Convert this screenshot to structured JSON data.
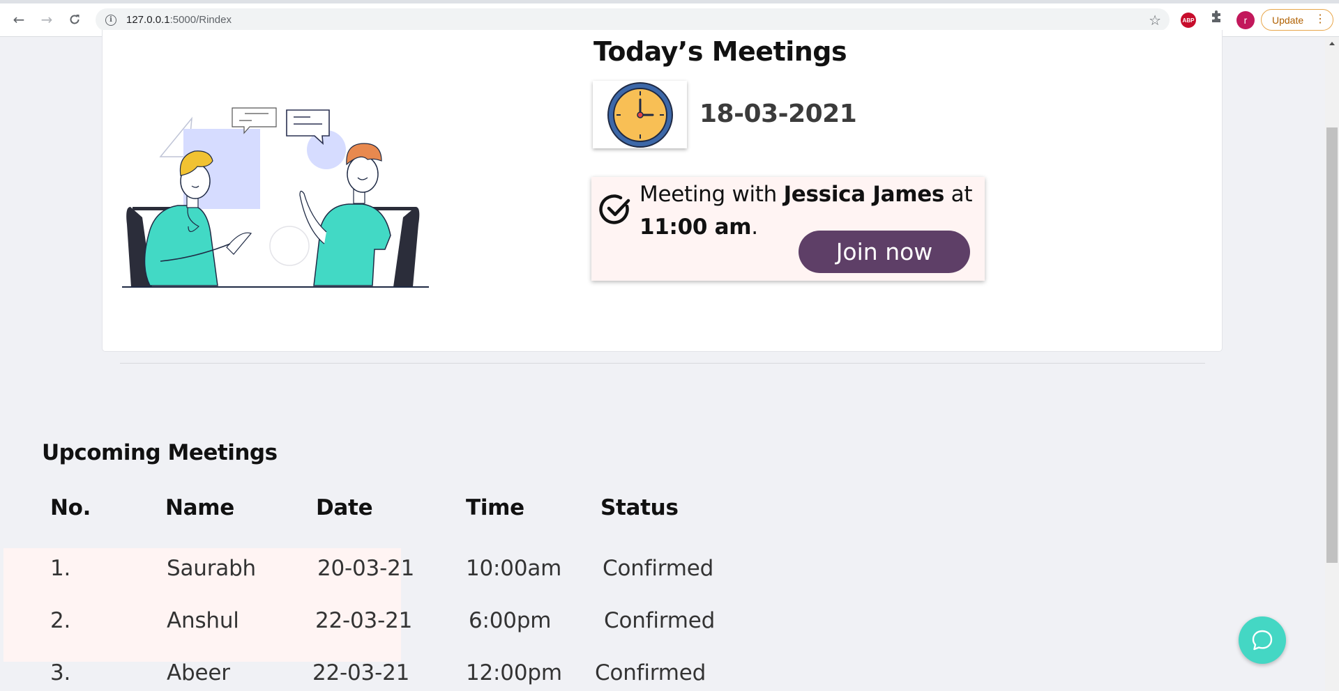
{
  "browser": {
    "url_host": "127.0.0.1",
    "url_path": ":5000/Rindex",
    "abp_label": "ABP",
    "profile_initial": "r",
    "update_label": "Update"
  },
  "today": {
    "title": "Today’s Meetings",
    "date": "18-03-2021",
    "meeting": {
      "prefix": "Meeting with ",
      "person": "Jessica James",
      "mid": " at ",
      "time": "11:00 am",
      "suffix": "."
    },
    "join_label": "Join now"
  },
  "upcoming": {
    "title": "Upcoming Meetings",
    "headers": {
      "no": "No.",
      "name": "Name",
      "date": "Date",
      "time": "Time",
      "status": "Status"
    },
    "rows": [
      {
        "no": "1.",
        "name": "Saurabh",
        "date": "20-03-21",
        "time": "10:00am",
        "status": "Confirmed"
      },
      {
        "no": "2.",
        "name": "Anshul",
        "date": "22-03-21",
        "time": "6:00pm",
        "status": "Confirmed"
      },
      {
        "no": "3.",
        "name": "Abeer",
        "date": "22-03-21",
        "time": "12:00pm",
        "status": "Confirmed"
      }
    ]
  }
}
